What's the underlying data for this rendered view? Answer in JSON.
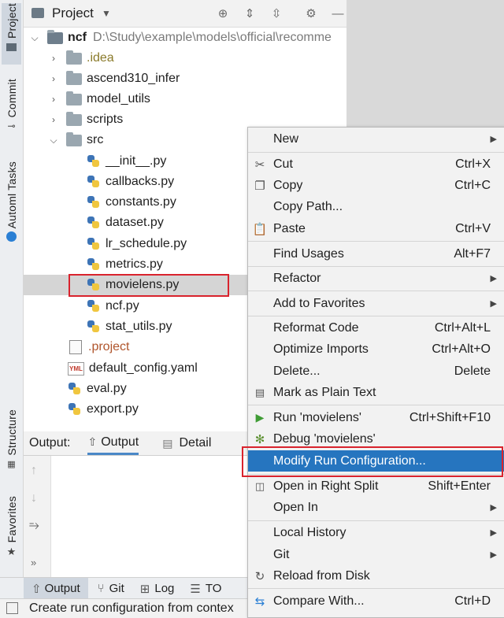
{
  "left_strip": {
    "project": "Project",
    "commit": "Commit",
    "automl": "Automl Tasks",
    "structure": "Structure",
    "favorites": "Favorites"
  },
  "project_panel": {
    "title": "Project",
    "tree": [
      {
        "label": "ncf",
        "path": "D:\\Study\\example\\models\\official\\recomme"
      },
      {
        "label": ".idea"
      },
      {
        "label": "ascend310_infer"
      },
      {
        "label": "model_utils"
      },
      {
        "label": "scripts"
      },
      {
        "label": "src"
      },
      {
        "label": "__init__.py"
      },
      {
        "label": "callbacks.py"
      },
      {
        "label": "constants.py"
      },
      {
        "label": "dataset.py"
      },
      {
        "label": "lr_schedule.py"
      },
      {
        "label": "metrics.py"
      },
      {
        "label": "movielens.py"
      },
      {
        "label": "ncf.py"
      },
      {
        "label": "stat_utils.py"
      },
      {
        "label": ".project"
      },
      {
        "label": "default_config.yaml"
      },
      {
        "label": "eval.py"
      },
      {
        "label": "export.py"
      }
    ],
    "yml_badge": "YML"
  },
  "output_panel": {
    "label": "Output:",
    "tab_output": "Output",
    "tab_detail": "Detail"
  },
  "bottom_bar": {
    "output": "Output",
    "git": "Git",
    "log": "Log",
    "to": "TO"
  },
  "status_bar": {
    "text": "Create run configuration from contex"
  },
  "context_menu": {
    "new": "New",
    "cut": "Cut",
    "cut_sc": "Ctrl+X",
    "copy": "Copy",
    "copy_sc": "Ctrl+C",
    "copy_path": "Copy Path...",
    "paste": "Paste",
    "paste_sc": "Ctrl+V",
    "find_usages": "Find Usages",
    "find_usages_sc": "Alt+F7",
    "refactor": "Refactor",
    "add_favorites": "Add to Favorites",
    "reformat": "Reformat Code",
    "reformat_sc": "Ctrl+Alt+L",
    "optimize": "Optimize Imports",
    "optimize_sc": "Ctrl+Alt+O",
    "delete": "Delete...",
    "delete_sc": "Delete",
    "mark_plain": "Mark as Plain Text",
    "run": "Run 'movielens'",
    "run_sc": "Ctrl+Shift+F10",
    "debug": "Debug 'movielens'",
    "modify_run": "Modify Run Configuration...",
    "open_split": "Open in Right Split",
    "open_split_sc": "Shift+Enter",
    "open_in": "Open In",
    "local_history": "Local History",
    "git": "Git",
    "reload": "Reload from Disk",
    "compare": "Compare With...",
    "compare_sc": "Ctrl+D"
  },
  "colors": {
    "highlight": "#2675bf",
    "annotation": "#d9232d",
    "run_green": "#3f9c35",
    "debug_green": "#5b8f2f"
  }
}
